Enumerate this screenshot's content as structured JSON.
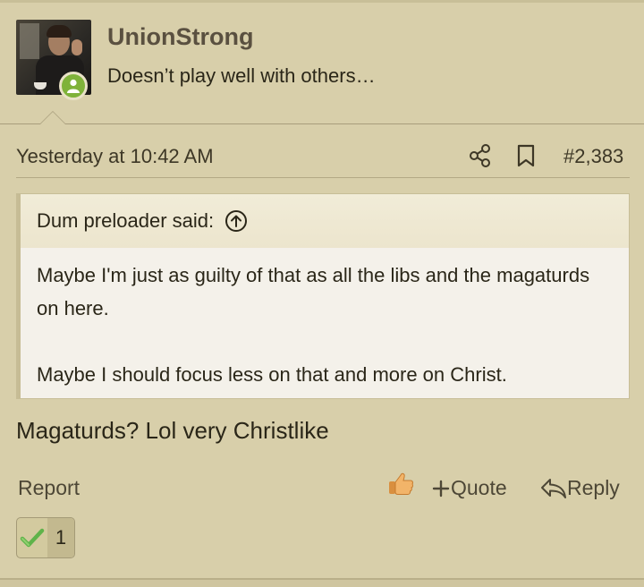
{
  "user": {
    "name": "UnionStrong",
    "title": "Doesn’t play well with others…",
    "avatar_icon": "user-avatar-photo",
    "status_icon": "online-person-icon",
    "status_color": "#7fb23a"
  },
  "post": {
    "date": "Yesterday at 10:42 AM",
    "number": "#2,383",
    "share_icon": "share-icon",
    "bookmark_icon": "bookmark-icon",
    "body": "Magaturds? Lol very Christlike"
  },
  "quote": {
    "author_line": "Dum preloader said:",
    "expand_icon": "arrow-up-circle-icon",
    "paragraph1": "Maybe I'm just as guilty of that as all the libs and the magaturds on here.",
    "paragraph2": "Maybe I should focus less on that and more on Christ."
  },
  "actions": {
    "report": "Report",
    "like_icon": "thumbs-up-icon",
    "quote_label": "Quote",
    "reply_label": "Reply"
  },
  "reactions": {
    "icon": "checkmark-icon",
    "count": "1"
  },
  "colors": {
    "background": "#d8cfaa",
    "quote_background": "#f4f1ea",
    "username": "#5a5040"
  }
}
